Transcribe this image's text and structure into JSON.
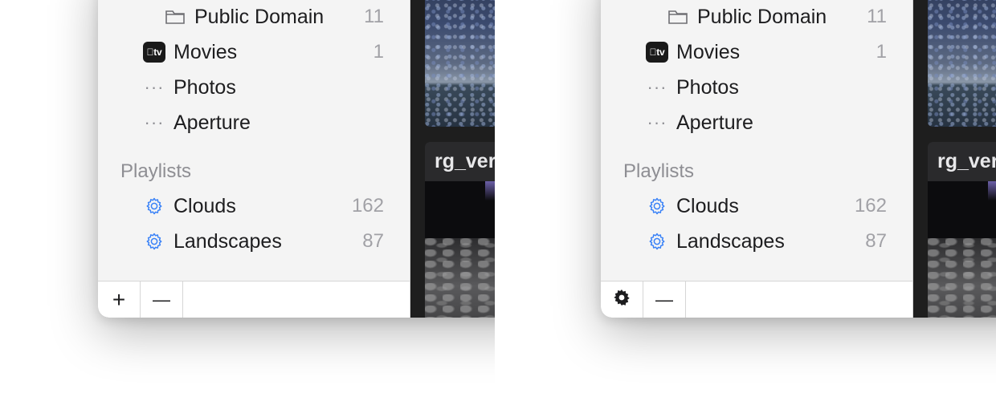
{
  "panels": [
    {
      "library_items": [
        {
          "label": "Public Domain",
          "count": "11"
        },
        {
          "label": "Movies",
          "count": "1"
        },
        {
          "label": "Photos",
          "count": ""
        },
        {
          "label": "Aperture",
          "count": ""
        }
      ],
      "tv_badge": "tv",
      "playlists_header": "Playlists",
      "playlists": [
        {
          "label": "Clouds",
          "count": "162"
        },
        {
          "label": "Landscapes",
          "count": "87"
        }
      ],
      "bottom_buttons": [
        {
          "name": "add-button",
          "glyph": "+"
        },
        {
          "name": "remove-button",
          "glyph": "—"
        }
      ],
      "thumbnail_title": "rg_ver"
    },
    {
      "library_items": [
        {
          "label": "Public Domain",
          "count": "11"
        },
        {
          "label": "Movies",
          "count": "1"
        },
        {
          "label": "Photos",
          "count": ""
        },
        {
          "label": "Aperture",
          "count": ""
        }
      ],
      "tv_badge": "tv",
      "playlists_header": "Playlists",
      "playlists": [
        {
          "label": "Clouds",
          "count": "162"
        },
        {
          "label": "Landscapes",
          "count": "87"
        }
      ],
      "bottom_buttons": [
        {
          "name": "settings-button",
          "glyph": "✱"
        },
        {
          "name": "remove-button",
          "glyph": "—"
        }
      ],
      "thumbnail_title": "rg_ver"
    }
  ]
}
